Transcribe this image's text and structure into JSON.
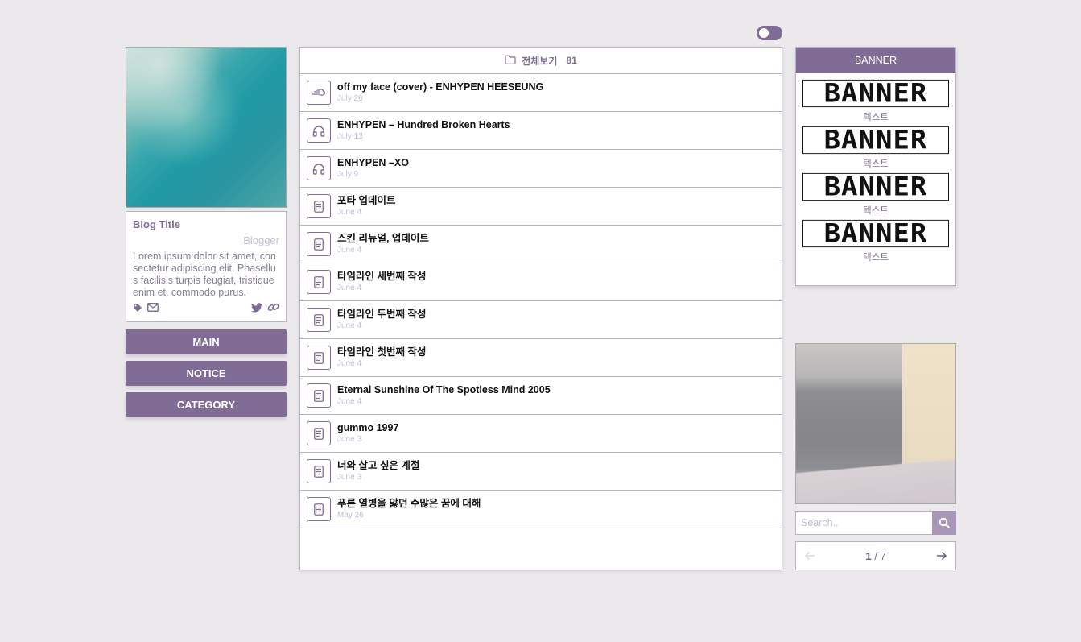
{
  "theme_toggle": {
    "state": "off"
  },
  "profile": {
    "title": "Blog Title",
    "author": "Blogger",
    "description": "Lorem ipsum dolor sit amet, consectetur adipiscing elit. Phasellus facilisis turpis feugiat, tristique enim et, commodo purus."
  },
  "nav": {
    "main": "MAIN",
    "notice": "NOTICE",
    "category": "CATEGORY"
  },
  "list": {
    "folder_label": "전체보기",
    "count": "81",
    "posts": [
      {
        "title": "off my face (cover) - ENHYPEN HEESEUNG",
        "date": "July 26",
        "icon": "soundcloud-icon"
      },
      {
        "title": "ENHYPEN – Hundred Broken Hearts",
        "date": "July 13",
        "icon": "headphones-icon"
      },
      {
        "title": "ENHYPEN –XO",
        "date": "July 9",
        "icon": "headphones-icon"
      },
      {
        "title": "포타 업데이트",
        "date": "June 4",
        "icon": "document-icon"
      },
      {
        "title": "스킨 리뉴얼, 업데이트",
        "date": "June 4",
        "icon": "document-icon"
      },
      {
        "title": "타임라인 세번째 작성",
        "date": "June 4",
        "icon": "document-icon"
      },
      {
        "title": "타임라인 두번째 작성",
        "date": "June 4",
        "icon": "document-icon"
      },
      {
        "title": "타임라인 첫번째 작성",
        "date": "June 4",
        "icon": "document-icon"
      },
      {
        "title": "Eternal Sunshine Of The Spotless Mind 2005",
        "date": "June 4",
        "icon": "document-icon"
      },
      {
        "title": "gummo 1997",
        "date": "June 3",
        "icon": "document-icon"
      },
      {
        "title": "너와 살고 싶은 계절",
        "date": "June 3",
        "icon": "document-icon"
      },
      {
        "title": "푸른 열병을 앓던 수많은 꿈에 대해",
        "date": "May 26",
        "icon": "document-icon"
      }
    ]
  },
  "banners": {
    "header": "BANNER",
    "items": [
      {
        "image_text": "BANNER",
        "caption": "텍스트"
      },
      {
        "image_text": "BANNER",
        "caption": "텍스트"
      },
      {
        "image_text": "BANNER",
        "caption": "텍스트"
      },
      {
        "image_text": "BANNER",
        "caption": "텍스트"
      }
    ]
  },
  "search": {
    "placeholder": "Search.."
  },
  "pagination": {
    "current": "1",
    "separator": "/",
    "total": "7"
  },
  "colors": {
    "accent": "#806c94",
    "background": "#ebe9ec",
    "muted": "#c4bdd8"
  }
}
